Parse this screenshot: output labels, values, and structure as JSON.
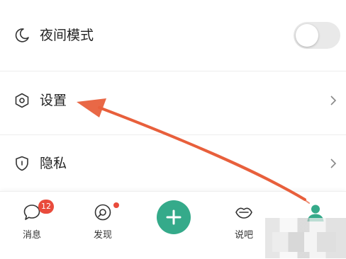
{
  "settings": {
    "night_mode_label": "夜间模式",
    "night_mode_on": false,
    "settings_label": "设置",
    "privacy_label": "隐私"
  },
  "tabbar": {
    "messages_label": "消息",
    "messages_badge": "12",
    "discover_label": "发现",
    "post_label": "+",
    "shuoba_label": "说吧"
  },
  "colors": {
    "accent": "#35aa8a",
    "badge": "#e94b3c",
    "annotation_arrow": "#e8603c"
  },
  "icons": [
    "moon-icon",
    "hexagon-settings-icon",
    "shield-icon",
    "chevron-right-icon",
    "chat-bubble-icon",
    "compass-icon",
    "plus-icon",
    "lips-icon",
    "user-avatar-icon"
  ]
}
